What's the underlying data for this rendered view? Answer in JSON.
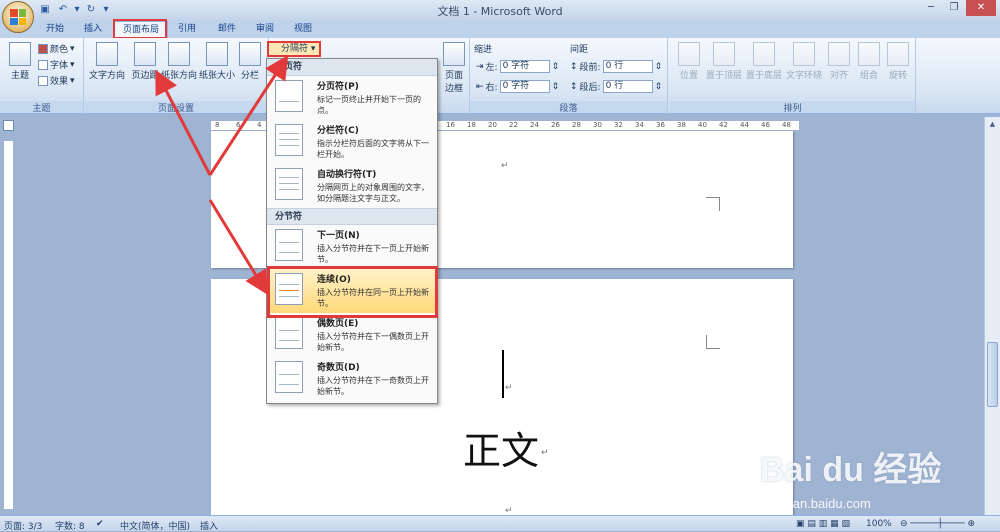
{
  "app": {
    "window_title": "文档 1 - Microsoft Word"
  },
  "tabs": [
    "开始",
    "插入",
    "页面布局",
    "引用",
    "邮件",
    "审阅",
    "视图"
  ],
  "active_tab": "页面布局",
  "ribbon": {
    "theme_group": {
      "label": "主题",
      "theme_btn": "主题",
      "colors": "颜色",
      "fonts": "字体",
      "effects": "效果"
    },
    "page_setup_group": {
      "label": "页面设置",
      "text_direction": "文字方向",
      "margins": "页边距",
      "orientation": "纸张方向",
      "size": "纸张大小",
      "columns": "分栏",
      "breaks_btn": "分隔符"
    },
    "page_bg_group": {
      "page_borders": "页面\n边框"
    },
    "paragraph_group": {
      "label": "段落",
      "indent_label": "缩进",
      "spacing_label": "间距",
      "left_label": "左:",
      "left_value": "0 字符",
      "right_label": "右:",
      "right_value": "0 字符",
      "before_label": "段前:",
      "before_value": "0 行",
      "after_label": "段后:",
      "after_value": "0 行"
    },
    "arrange_group": {
      "label": "排列",
      "position": "位置",
      "bring_front": "置于顶层",
      "send_back": "置于底层",
      "text_wrap": "文字环绕",
      "align": "对齐",
      "group": "组合",
      "rotate": "旋转"
    }
  },
  "dropdown": {
    "page_breaks_header": "分页符",
    "section_breaks_header": "分节符",
    "items": [
      {
        "title": "分页符(P)",
        "desc": "标记一页终止并开始下一页的点。"
      },
      {
        "title": "分栏符(C)",
        "desc": "指示分栏符后面的文字将从下一栏开始。"
      },
      {
        "title": "自动换行符(T)",
        "desc": "分隔网页上的对象周围的文字，如分隔题注文字与正文。"
      },
      {
        "title": "下一页(N)",
        "desc": "插入分节符并在下一页上开始新节。"
      },
      {
        "title": "连续(O)",
        "desc": "插入分节符并在同一页上开始新节。"
      },
      {
        "title": "偶数页(E)",
        "desc": "插入分节符并在下一偶数页上开始新节。"
      },
      {
        "title": "奇数页(D)",
        "desc": "插入分节符并在下一奇数页上开始新节。"
      }
    ],
    "selected_index": 4
  },
  "ruler_ticks": [
    "8",
    "6",
    "4",
    "2",
    "2",
    "4",
    "6",
    "8",
    "10",
    "12",
    "14",
    "16",
    "18",
    "20",
    "22",
    "24",
    "26",
    "28",
    "30",
    "32",
    "34",
    "36",
    "38",
    "40",
    "42",
    "44",
    "46",
    "48"
  ],
  "document": {
    "body_text": "正文",
    "para_mark": "↵"
  },
  "status": {
    "page": "页面: 3/3",
    "words": "字数: 8",
    "language": "中文(简体，中国)",
    "mode": "插入",
    "zoom": "100%"
  },
  "watermark": {
    "brand": "Bai du 经验",
    "url": "jingyan.baidu.com"
  },
  "colors": {
    "highlight_red": "#e23a3a",
    "selected_item": "#ffd87a"
  }
}
